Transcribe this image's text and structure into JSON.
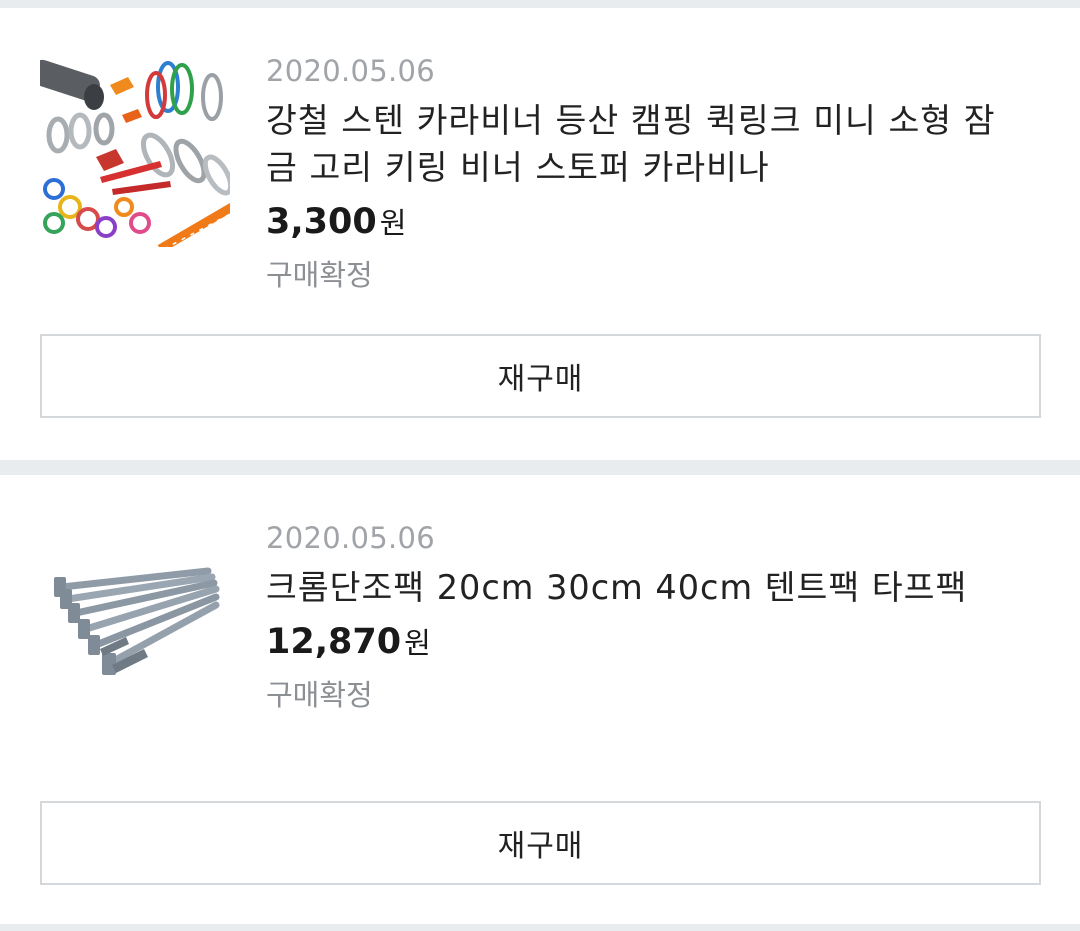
{
  "orders": [
    {
      "date": "2020.05.06",
      "title": "강철 스텐 카라비너 등산 캠핑 퀵링크 미니 소형 잠금 고리 키링 비너 스토퍼 카라비나",
      "price": "3,300",
      "currency": "원",
      "status": "구매확정",
      "rebuy_label": "재구매",
      "thumbnail": "carabiner-assortment-image"
    },
    {
      "date": "2020.05.06",
      "title": "크롬단조팩 20cm 30cm 40cm 텐트팩 타프팩",
      "price": "12,870",
      "currency": "원",
      "status": "구매확정",
      "rebuy_label": "재구매",
      "thumbnail": "tent-peg-set-image"
    }
  ],
  "colors": {
    "background": "#e9ecef",
    "card": "#ffffff",
    "date_text": "#a0a4a8",
    "status_text": "#8c9095",
    "button_border": "#d5d8db"
  }
}
